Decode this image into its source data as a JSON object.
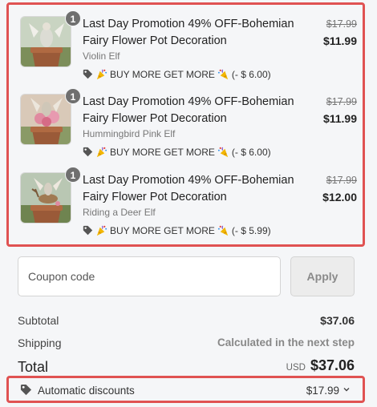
{
  "cart": {
    "items": [
      {
        "quantity": "1",
        "title": "Last Day Promotion 49% OFF-Bohemian Fairy Flower Pot Decoration",
        "variant": "Violin Elf",
        "promo_label": "BUY MORE GET MORE",
        "promo_discount": "(- $ 6.00)",
        "original_price": "$17.99",
        "price": "$11.99"
      },
      {
        "quantity": "1",
        "title": "Last Day Promotion 49% OFF-Bohemian Fairy Flower Pot Decoration",
        "variant": "Hummingbird Pink Elf",
        "promo_label": "BUY MORE GET MORE",
        "promo_discount": "(- $ 6.00)",
        "original_price": "$17.99",
        "price": "$11.99"
      },
      {
        "quantity": "1",
        "title": "Last Day Promotion 49% OFF-Bohemian Fairy Flower Pot Decoration",
        "variant": "Riding a Deer Elf",
        "promo_label": "BUY MORE GET MORE",
        "promo_discount": "(- $ 5.99)",
        "original_price": "$17.99",
        "price": "$12.00"
      }
    ]
  },
  "coupon": {
    "placeholder": "Coupon code",
    "apply_label": "Apply"
  },
  "summary": {
    "subtotal_label": "Subtotal",
    "subtotal_value": "$37.06",
    "shipping_label": "Shipping",
    "shipping_value": "Calculated in the next step",
    "total_label": "Total",
    "currency": "USD",
    "total_value": "$37.06"
  },
  "discounts": {
    "label": "Automatic discounts",
    "value": "$17.99",
    "icon": "tag-icon"
  },
  "colors": {
    "highlight_border": "#e05252",
    "qty_badge": "#6f6f6f"
  }
}
